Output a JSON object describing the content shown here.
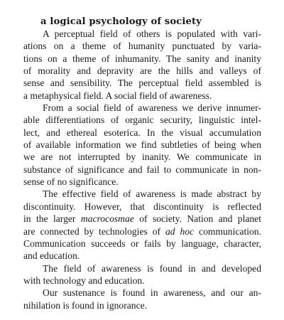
{
  "title": "a logical psychology of society",
  "paragraphs": [
    {
      "lines": [
        "A perceptual field of others is populated with vari-",
        "ations on a theme of humanity punctuated by varia-",
        "tions on a theme of inhumanity. The sanity and inanity",
        "of morality and depravity are the hills and valleys of",
        "sense and sensibility. The perceptual field assembled is",
        "a metaphysical field. A social field of awareness."
      ]
    },
    {
      "lines": [
        "From a social field of awareness we derive innumer-",
        "able differentiations of organic security, linguistic intel-",
        "lect, and ethereal esoterica. In the visual accumulation",
        "of available information we find subtleties of being when",
        "we are not interrupted by inanity. We communicate in",
        "substance of significance and fail to communicate in non-",
        "sense of no significance."
      ]
    },
    {
      "lines": [
        "The effective field of awareness is made abstract by",
        "discontinuity. However, that discontinuity is reflected",
        "in the larger |macrocosmae| of society. Nation and planet",
        "are connected by technologies of |ad hoc| communication.",
        "Communication succeeds or fails by language, character,",
        "and education."
      ]
    },
    {
      "lines": [
        "The field of awareness is found in and developed",
        "with technology and education."
      ]
    },
    {
      "lines": [
        "Our sustenance is found in awareness, and our an-",
        "nihilation is found in ignorance."
      ]
    }
  ]
}
